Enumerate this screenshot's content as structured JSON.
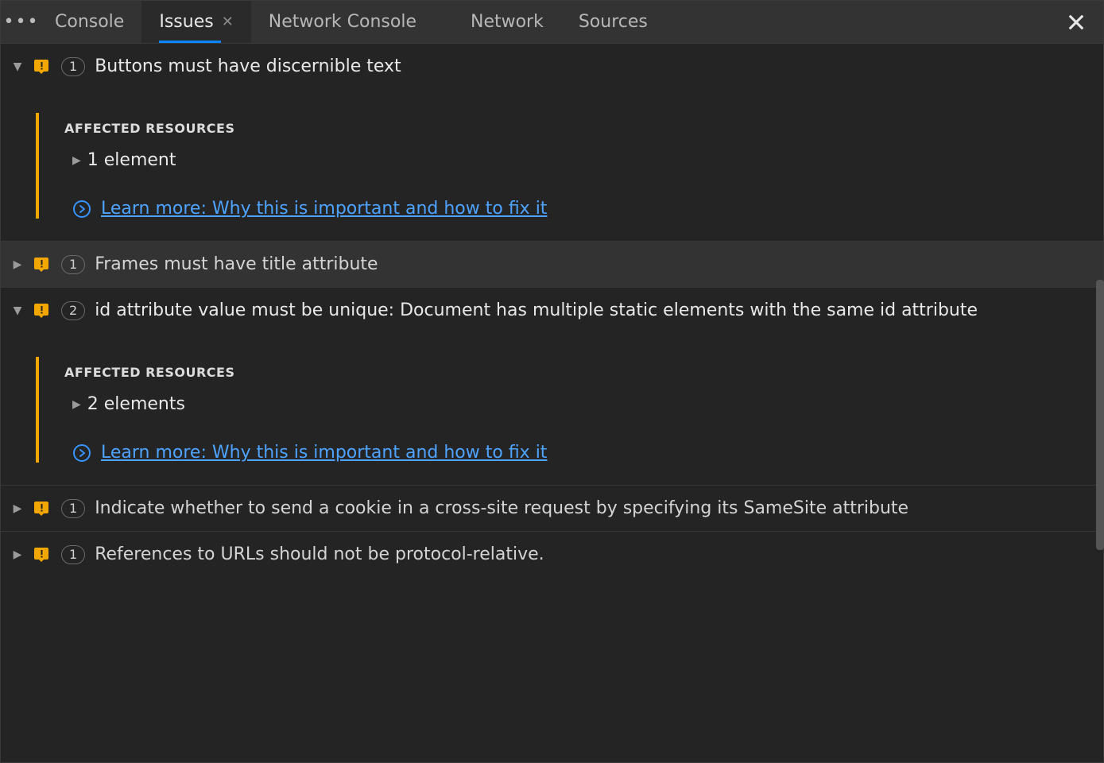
{
  "tabs": {
    "items": [
      {
        "label": "Console"
      },
      {
        "label": "Issues"
      },
      {
        "label": "Network Console"
      },
      {
        "label": "Network"
      },
      {
        "label": "Sources"
      }
    ],
    "active_index": 1
  },
  "section_label": "AFFECTED RESOURCES",
  "learn_more_text": "Learn more: Why this is important and how to fix it",
  "issues": [
    {
      "title": "Buttons must have discernible text",
      "count": "1",
      "expanded": true,
      "elements_label": "1 element"
    },
    {
      "title": "Frames must have title attribute",
      "count": "1",
      "expanded": false
    },
    {
      "title": "id attribute value must be unique: Document has multiple static elements with the same id attribute",
      "count": "2",
      "expanded": true,
      "elements_label": "2 elements"
    },
    {
      "title": "Indicate whether to send a cookie in a cross-site request by specifying its SameSite attribute",
      "count": "1",
      "expanded": false
    },
    {
      "title": "References to URLs should not be protocol-relative.",
      "count": "1",
      "expanded": false
    }
  ]
}
